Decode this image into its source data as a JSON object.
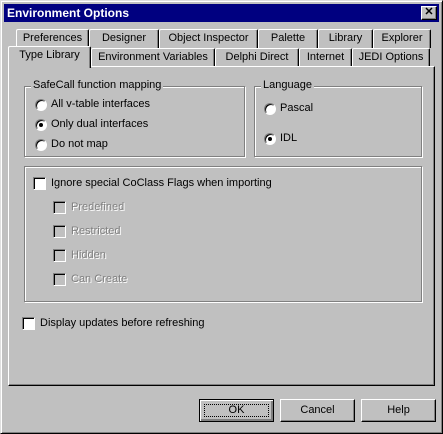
{
  "window": {
    "title": "Environment Options"
  },
  "tabs_back": [
    {
      "label": "Preferences"
    },
    {
      "label": "Designer"
    },
    {
      "label": "Object Inspector"
    },
    {
      "label": "Palette"
    },
    {
      "label": "Library"
    },
    {
      "label": "Explorer"
    }
  ],
  "tabs_front": [
    {
      "label": "Type Library",
      "active": true
    },
    {
      "label": "Environment Variables"
    },
    {
      "label": "Delphi Direct"
    },
    {
      "label": "Internet"
    },
    {
      "label": "JEDI Options"
    }
  ],
  "safecall": {
    "title": "SafeCall function mapping",
    "options": [
      {
        "label": "All v-table interfaces",
        "checked": false
      },
      {
        "label": "Only dual interfaces",
        "checked": true
      },
      {
        "label": "Do not map",
        "checked": false
      }
    ]
  },
  "language": {
    "title": "Language",
    "options": [
      {
        "label": "Pascal",
        "checked": false
      },
      {
        "label": "IDL",
        "checked": true
      }
    ]
  },
  "coclass": {
    "label": "Ignore special CoClass Flags when importing",
    "checked": false,
    "flags": [
      {
        "label": "Predefined",
        "checked": false,
        "enabled": false
      },
      {
        "label": "Restricted",
        "checked": false,
        "enabled": false
      },
      {
        "label": "Hidden",
        "checked": false,
        "enabled": false
      },
      {
        "label": "Can Create",
        "checked": false,
        "enabled": false
      }
    ]
  },
  "display_updates": {
    "label": "Display updates before refreshing",
    "checked": false
  },
  "buttons": {
    "ok": "OK",
    "cancel": "Cancel",
    "help": "Help"
  }
}
